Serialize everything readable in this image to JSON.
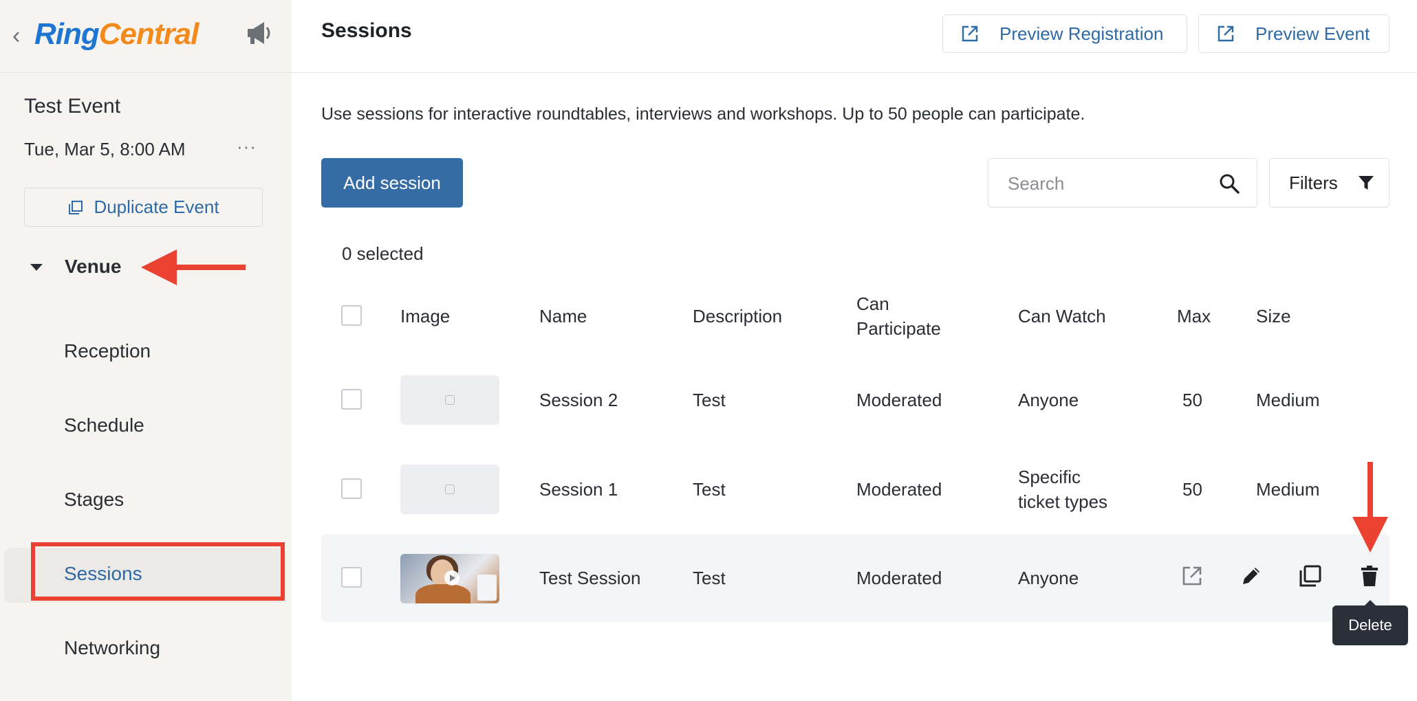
{
  "sidebar": {
    "logo_ring": "Ring",
    "logo_central": "Central",
    "event_title": "Test Event",
    "event_date": "Tue, Mar 5, 8:00 AM",
    "more_label": "···",
    "duplicate_label": "Duplicate Event",
    "venue_label": "Venue",
    "nav": [
      {
        "label": "Reception"
      },
      {
        "label": "Schedule"
      },
      {
        "label": "Stages"
      },
      {
        "label": "Sessions",
        "active": true
      },
      {
        "label": "Networking"
      }
    ]
  },
  "header": {
    "title": "Sessions",
    "preview_registration": "Preview Registration",
    "preview_event": "Preview Event"
  },
  "main": {
    "intro": "Use sessions for interactive roundtables, interviews and workshops. Up to 50 people can participate.",
    "add_session": "Add session",
    "search_placeholder": "Search",
    "filters": "Filters",
    "selected_count": "0 selected"
  },
  "table": {
    "columns": {
      "image": "Image",
      "name": "Name",
      "description": "Description",
      "can_participate_1": "Can",
      "can_participate_2": "Participate",
      "can_watch": "Can Watch",
      "max": "Max",
      "size": "Size"
    },
    "rows": [
      {
        "name": "Session 2",
        "description": "Test",
        "can_participate": "Moderated",
        "can_watch_1": "Anyone",
        "can_watch_2": "",
        "max": "50",
        "size": "Medium"
      },
      {
        "name": "Session 1",
        "description": "Test",
        "can_participate": "Moderated",
        "can_watch_1": "Specific",
        "can_watch_2": "ticket types",
        "max": "50",
        "size": "Medium"
      },
      {
        "name": "Test Session",
        "description": "Test",
        "can_participate": "Moderated",
        "can_watch_1": "Anyone",
        "can_watch_2": "",
        "max": "",
        "size": ""
      }
    ]
  },
  "tooltip": {
    "label": "Delete"
  },
  "colors": {
    "accent": "#356ca6",
    "link": "#2e6aa6",
    "annotation": "#ea4130",
    "sidebar_bg": "#f6f4f1"
  }
}
